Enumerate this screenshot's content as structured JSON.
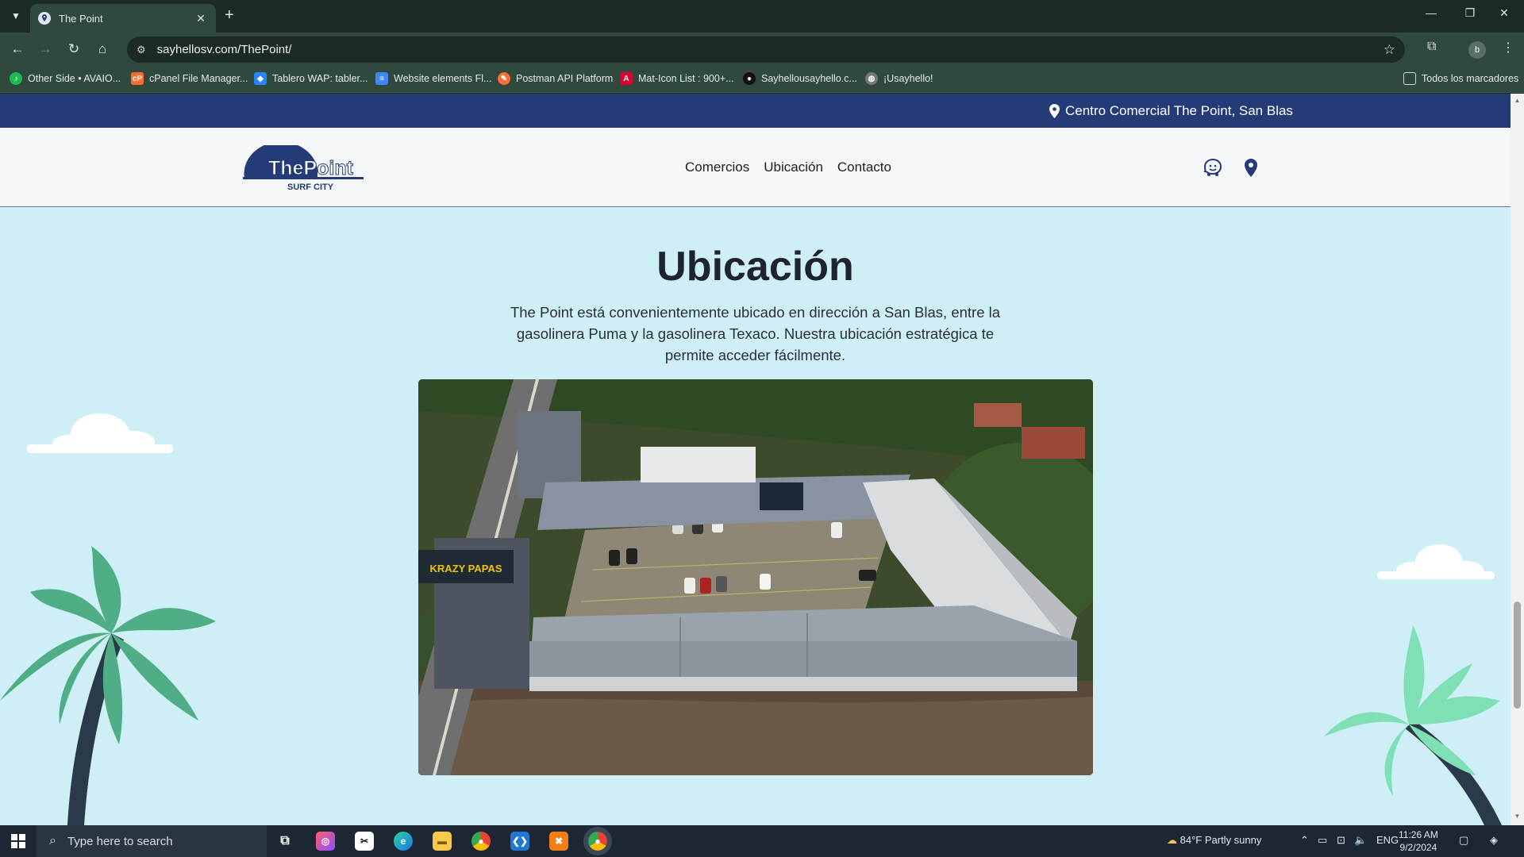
{
  "browser": {
    "tab_title": "The Point",
    "url": "sayhellosv.com/ThePoint/",
    "bookmarks": [
      {
        "label": "Other Side • AVAIO...",
        "icon": "spotify-icon",
        "color": "#1db954"
      },
      {
        "label": "cPanel File Manager...",
        "icon": "cpanel-icon",
        "color": "#ff6c2c"
      },
      {
        "label": "Tablero WAP: tabler...",
        "icon": "jira-icon",
        "color": "#2684ff"
      },
      {
        "label": "Website elements Fl...",
        "icon": "docs-icon",
        "color": "#4285f4"
      },
      {
        "label": "Postman API Platform",
        "icon": "postman-icon",
        "color": "#ff6c37"
      },
      {
        "label": "Mat-Icon List : 900+...",
        "icon": "angular-icon",
        "color": "#dd0031"
      },
      {
        "label": "Sayhellousayhello.c...",
        "icon": "sayhello-icon",
        "color": "#111111"
      },
      {
        "label": "¡Usayhello!",
        "icon": "globe-icon",
        "color": "#777777"
      }
    ],
    "all_bookmarks": "Todos los marcadores",
    "profile_initial": "b"
  },
  "site": {
    "topbar_location": "Centro Comercial The Point, San Blas",
    "logo_main": "ThePoint",
    "logo_sub": "SURF CITY",
    "nav": [
      "Comercios",
      "Ubicación",
      "Contacto"
    ],
    "brand_color": "#243b78"
  },
  "section": {
    "title": "Ubicación",
    "description": "The Point está convenientemente ubicado en dirección a San Blas, entre la gasolinera Puma y la gasolinera Texaco. Nuestra ubicación estratégica te permite acceder fácilmente.",
    "image_text": "KRAZY PAPAS"
  },
  "taskbar": {
    "search_placeholder": "Type here to search",
    "weather": "84°F  Partly sunny",
    "language": "ENG",
    "time": "11:26 AM",
    "date": "9/2/2024"
  }
}
